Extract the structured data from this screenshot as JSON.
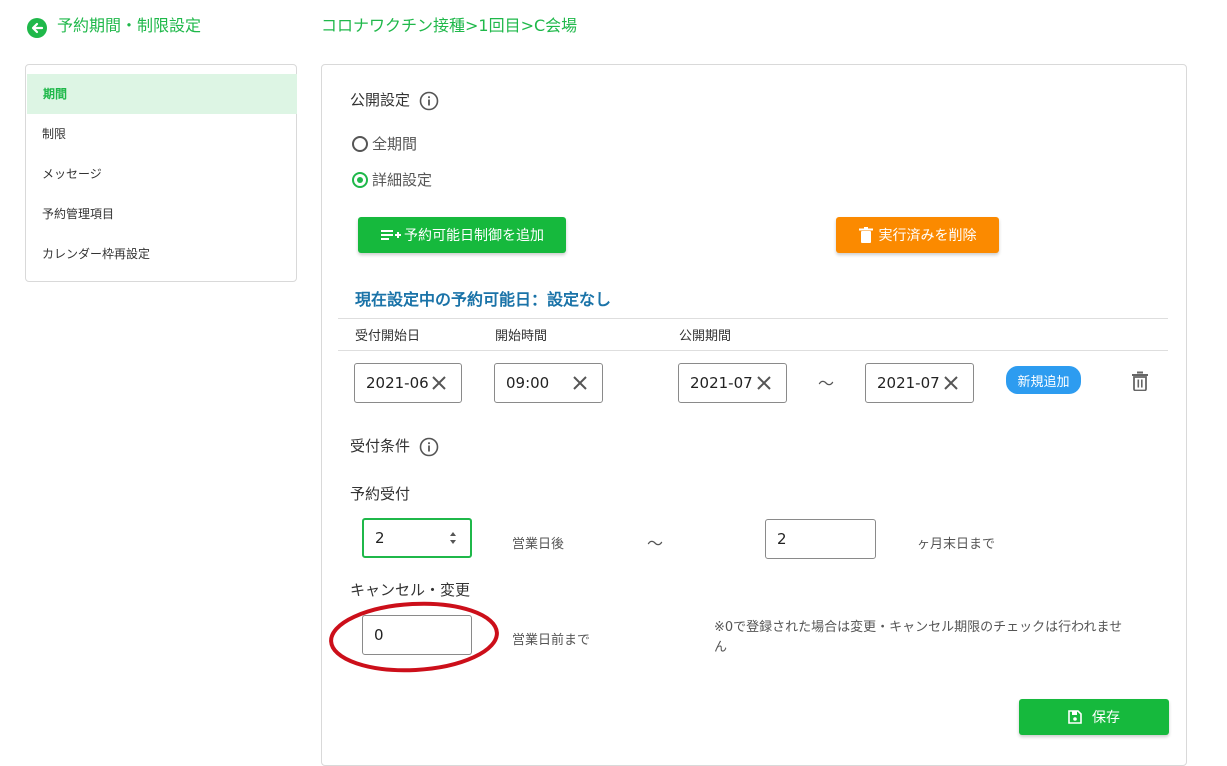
{
  "header": {
    "title": "予約期間・制限設定",
    "breadcrumb": "コロナワクチン接種>1回目>C会場"
  },
  "sidebar": {
    "items": [
      {
        "label": "期間",
        "active": true
      },
      {
        "label": "制限"
      },
      {
        "label": "メッセージ"
      },
      {
        "label": "予約管理項目"
      },
      {
        "label": "カレンダー枠再設定"
      }
    ]
  },
  "publish": {
    "title": "公開設定",
    "options": [
      {
        "label": "全期間",
        "checked": false
      },
      {
        "label": "詳細設定",
        "checked": true
      }
    ],
    "add_button": "予約可能日制御を追加",
    "delete_button": "実行済みを削除"
  },
  "current": {
    "title": "現在設定中の予約可能日：設定なし",
    "headers": [
      "受付開始日",
      "開始時間",
      "公開期間"
    ],
    "start_date": "2021-06",
    "start_time": "09:00",
    "period_from": "2021-07",
    "period_to": "2021-07",
    "tilde": "〜",
    "new_button": "新規追加"
  },
  "conditions": {
    "title": "受付条件",
    "reservation_label": "予約受付",
    "reservation_days": "2",
    "business_days_after": "営業日後",
    "tilde": "〜",
    "months": "2",
    "month_end": "ヶ月末日まで",
    "cancel_label": "キャンセル・変更",
    "cancel_days": "0",
    "business_days_before": "営業日前まで",
    "note": "※0で登録された場合は変更・キャンセル期限のチェックは行われません"
  },
  "save_button": "保存",
  "colors": {
    "accent_green": "#1fb84a",
    "orange": "#fb8a00",
    "blue_title": "#1a73a8",
    "pill_blue": "#2d9cf0",
    "annotation_red": "#cc0f1a"
  }
}
